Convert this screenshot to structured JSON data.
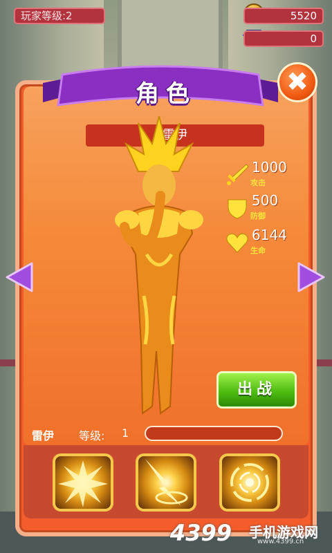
{
  "hud": {
    "player_level": "玩家等级:2",
    "coins": "5520",
    "gems": "0"
  },
  "panel": {
    "title": "角色",
    "hero_name_banner": "雷伊",
    "close_glyph": "✖"
  },
  "stats": {
    "attack": {
      "value": "1000",
      "label": "攻击",
      "icon": "sword-icon"
    },
    "defense": {
      "value": "500",
      "label": "防御",
      "icon": "shield-icon"
    },
    "health": {
      "value": "6144",
      "label": "生命",
      "icon": "heart-icon"
    }
  },
  "deploy_label": "出战",
  "hero_info": {
    "name": "雷伊",
    "level_label": "等级:",
    "level_value": "1",
    "exp_fill": 0
  },
  "skills": [
    {
      "icon": "burst-skill-icon"
    },
    {
      "icon": "lightning-strike-skill-icon"
    },
    {
      "icon": "vortex-skill-icon"
    }
  ],
  "watermark": {
    "brand_number": "4399",
    "brand_text": "手机游戏网",
    "url": "www.4399.cn"
  },
  "colors": {
    "panel": "#f45c2b",
    "ribbon": "#8a2fc2",
    "deploy": "#4fbd11",
    "stat_label": "#ffe23c"
  }
}
